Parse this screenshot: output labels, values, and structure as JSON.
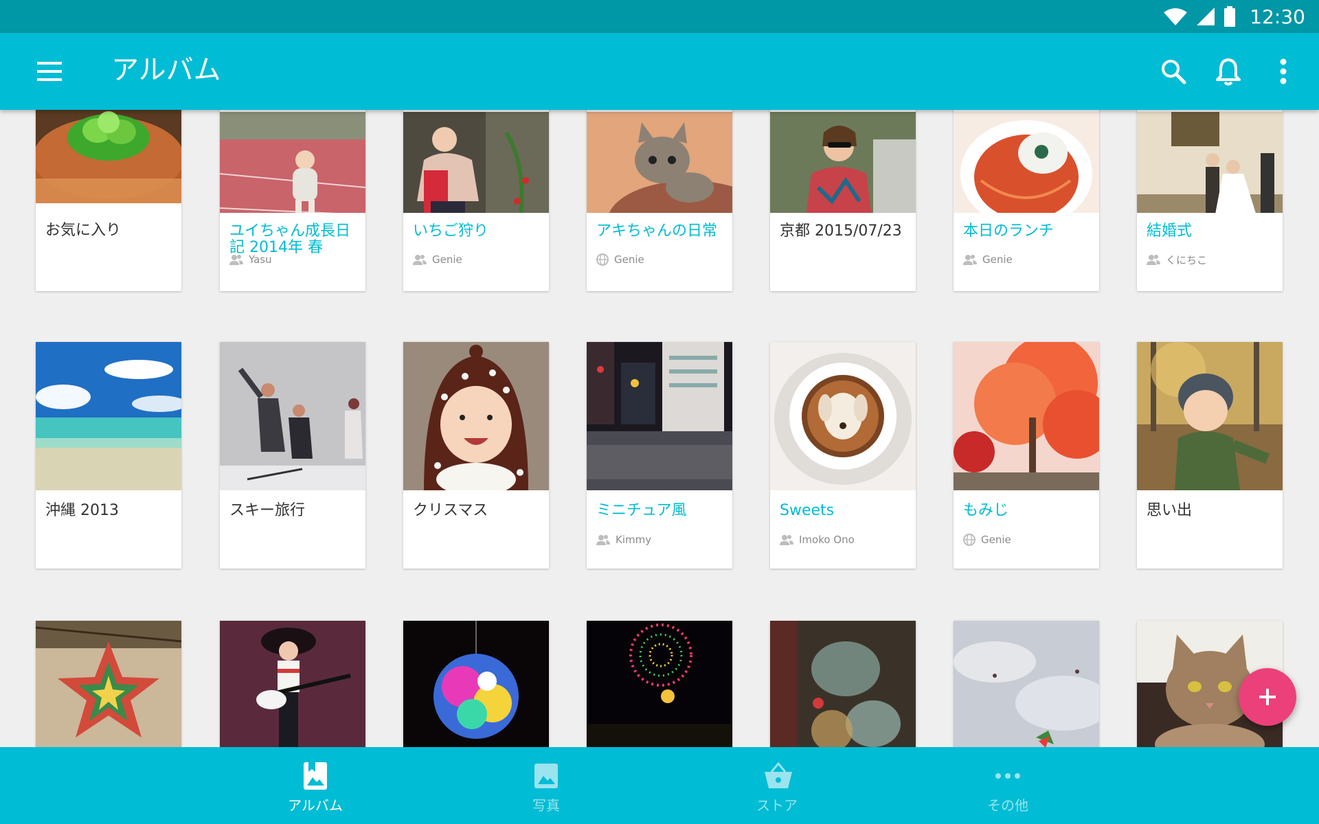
{
  "status_bar": {
    "time": "12:30"
  },
  "toolbar": {
    "title": "アルバム",
    "color": "#00bcd4"
  },
  "albums": [
    {
      "title": "お気に入り",
      "owner": "",
      "shared": false,
      "thumb": "succulent-jar"
    },
    {
      "title": "ユイちゃん成長日記 2014年 春",
      "owner": "Yasu",
      "shared": true,
      "owner_icon": "people-icon",
      "thumb": "toddler-running"
    },
    {
      "title": "いちご狩り",
      "owner": "Genie",
      "shared": true,
      "owner_icon": "people-icon",
      "thumb": "strawberry-picking"
    },
    {
      "title": "アキちゃんの日常",
      "owner": "Genie",
      "shared": true,
      "owner_icon": "globe-icon",
      "thumb": "kitten"
    },
    {
      "title": "京都 2015/07/23",
      "owner": "",
      "shared": false,
      "thumb": "woman-sunglasses"
    },
    {
      "title": "本日のランチ",
      "owner": "Genie",
      "shared": true,
      "owner_icon": "people-icon",
      "thumb": "pasta"
    },
    {
      "title": "結婚式",
      "owner": "くにちこ",
      "shared": true,
      "owner_icon": "people-icon",
      "thumb": "wedding"
    },
    {
      "title": "沖縄 2013",
      "owner": "",
      "shared": false,
      "thumb": "beach"
    },
    {
      "title": "スキー旅行",
      "owner": "",
      "shared": false,
      "thumb": "skiers"
    },
    {
      "title": "クリスマス",
      "owner": "",
      "shared": false,
      "thumb": "child-hood"
    },
    {
      "title": "ミニチュア風",
      "owner": "Kimmy",
      "shared": true,
      "owner_icon": "people-icon",
      "thumb": "city-night"
    },
    {
      "title": "Sweets",
      "owner": "Imoko Ono",
      "shared": true,
      "owner_icon": "people-icon",
      "thumb": "latte-art"
    },
    {
      "title": "もみじ",
      "owner": "Genie",
      "shared": true,
      "owner_icon": "globe-icon",
      "thumb": "autumn-tree"
    },
    {
      "title": "思い出",
      "owner": "",
      "shared": false,
      "thumb": "boy-helmet"
    },
    {
      "title": "",
      "owner": "",
      "shared": false,
      "thumb": "paper-star"
    },
    {
      "title": "",
      "owner": "",
      "shared": false,
      "thumb": "guitarist"
    },
    {
      "title": "",
      "owner": "",
      "shared": false,
      "thumb": "disco-ball"
    },
    {
      "title": "",
      "owner": "",
      "shared": false,
      "thumb": "fireworks"
    },
    {
      "title": "",
      "owner": "",
      "shared": false,
      "thumb": "glass-jars"
    },
    {
      "title": "",
      "owner": "",
      "shared": false,
      "thumb": "kites-sky"
    },
    {
      "title": "",
      "owner": "",
      "shared": false,
      "thumb": "tabby-cat"
    }
  ],
  "bottom_nav": [
    {
      "label": "アルバム",
      "icon": "album-icon",
      "active": true
    },
    {
      "label": "写真",
      "icon": "photo-icon",
      "active": false
    },
    {
      "label": "ストア",
      "icon": "store-basket-icon",
      "active": false
    },
    {
      "label": "その他",
      "icon": "more-horiz-icon",
      "active": false
    }
  ],
  "fab": {
    "icon": "plus-icon",
    "color": "#ec407a"
  }
}
